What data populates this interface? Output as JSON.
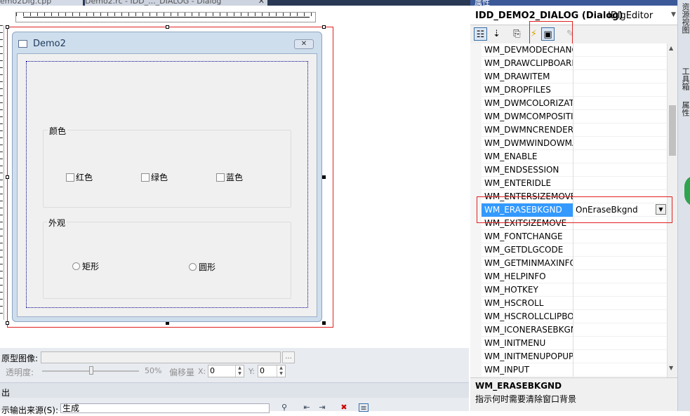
{
  "tabs": [
    {
      "label": "emo2Dlg.cpp"
    },
    {
      "label": "Demo2.rc - IDD_..._DIALOG - Dialog",
      "close": "✕"
    }
  ],
  "dialog": {
    "title": "Demo2",
    "close_glyph": "✕",
    "groups": [
      {
        "label": "颜色",
        "checkboxes": [
          "红色",
          "绿色",
          "蓝色"
        ]
      },
      {
        "label": "外观",
        "radios": [
          "矩形",
          "圆形"
        ]
      }
    ]
  },
  "image_props": {
    "prototype_label": "原型图像:",
    "browse_label": "...",
    "opacity_label": "透明度:",
    "opacity_value": "50%",
    "offset_label": "偏移量",
    "x_label": "X:",
    "x_value": "0",
    "y_label": "Y:",
    "y_value": "0"
  },
  "output": {
    "label": "出",
    "source_label": "示输出来源(S):",
    "source_value": "生成"
  },
  "properties_panel": {
    "title": "属性",
    "object_name": "IDD_DEMO2_DIALOG (Dialog)",
    "object_type": "IDlgEditor",
    "toolbar": [
      "categorized-icon",
      "alphabetical-icon",
      "property-pages-icon",
      "events-icon",
      "messages-icon",
      "overrides-icon"
    ],
    "messages": [
      {
        "name": "WM_DEVMODECHANGE",
        "handler": ""
      },
      {
        "name": "WM_DRAWCLIPBOARD",
        "handler": ""
      },
      {
        "name": "WM_DRAWITEM",
        "handler": ""
      },
      {
        "name": "WM_DROPFILES",
        "handler": ""
      },
      {
        "name": "WM_DWMCOLORIZATIONCOLORCHANGED",
        "handler": ""
      },
      {
        "name": "WM_DWMCOMPOSITIONCHANGED",
        "handler": ""
      },
      {
        "name": "WM_DWMNCRENDERINGCHANGED",
        "handler": ""
      },
      {
        "name": "WM_DWMWINDOWMAXIMIZEDCHANGE",
        "handler": ""
      },
      {
        "name": "WM_ENABLE",
        "handler": ""
      },
      {
        "name": "WM_ENDSESSION",
        "handler": ""
      },
      {
        "name": "WM_ENTERIDLE",
        "handler": ""
      },
      {
        "name": "WM_ENTERSIZEMOVE",
        "handler": ""
      },
      {
        "name": "WM_ERASEBKGND",
        "handler": "OnEraseBkgnd",
        "selected": true
      },
      {
        "name": "WM_EXITSIZEMOVE",
        "handler": ""
      },
      {
        "name": "WM_FONTCHANGE",
        "handler": ""
      },
      {
        "name": "WM_GETDLGCODE",
        "handler": ""
      },
      {
        "name": "WM_GETMINMAXINFO",
        "handler": ""
      },
      {
        "name": "WM_HELPINFO",
        "handler": ""
      },
      {
        "name": "WM_HOTKEY",
        "handler": ""
      },
      {
        "name": "WM_HSCROLL",
        "handler": ""
      },
      {
        "name": "WM_HSCROLLCLIPBOARD",
        "handler": ""
      },
      {
        "name": "WM_ICONERASEBKGND",
        "handler": ""
      },
      {
        "name": "WM_INITMENU",
        "handler": ""
      },
      {
        "name": "WM_INITMENUPOPUP",
        "handler": ""
      },
      {
        "name": "WM_INPUT",
        "handler": ""
      }
    ],
    "description": {
      "name": "WM_ERASEBKGND",
      "text": "指示何时需要清除窗口背景"
    }
  },
  "side_tabs": [
    "资源视图",
    "工具箱",
    "属性"
  ]
}
